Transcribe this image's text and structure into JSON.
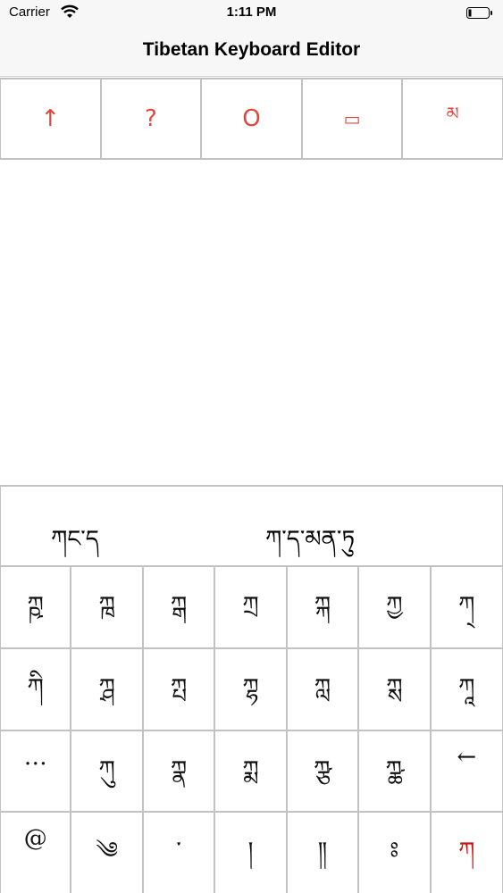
{
  "status_bar": {
    "carrier": "Carrier",
    "time": "1:11 PM"
  },
  "nav": {
    "title": "Tibetan Keyboard Editor"
  },
  "toolbar": {
    "buttons": [
      {
        "label": "↑",
        "icon": "arrow-up-icon"
      },
      {
        "label": "?",
        "icon": "question-icon"
      },
      {
        "label": "O",
        "icon": "circle-icon"
      },
      {
        "label": "▭",
        "icon": "rectangle-icon"
      },
      {
        "label": "མ",
        "icon": "tibetan-ma-icon"
      }
    ],
    "accent_color": "#e5453a"
  },
  "keyboard": {
    "suggestions": [
      "ཀང་ད",
      "ཀ་ད་མན་ཏུ"
    ],
    "rows": [
      [
        "ཀྵ",
        "ཀྑ",
        "ཀྒ",
        "ཀྲ",
        "ཀྐ",
        "ཀྱ",
        "ཀ྄"
      ],
      [
        "ཀི",
        "ཀྴ",
        "ཀྤ",
        "ཀྷ",
        "ཀླ",
        "ཀྶ",
        "ཀཱ"
      ],
      [
        "…",
        "ཀུ",
        "ཀྣ",
        "ཀྨ",
        "ཀྩ",
        "ཀྪ",
        "←"
      ],
      [
        "@",
        "༄",
        "་",
        "།",
        "༎",
        "ཿ",
        "ཀ"
      ]
    ],
    "highlight_color": "#cc1616"
  }
}
